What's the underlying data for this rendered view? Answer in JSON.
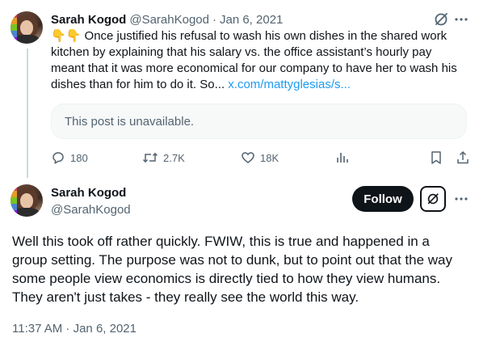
{
  "tweet1": {
    "author_name": "Sarah Kogod",
    "handle": "@SarahKogod",
    "separator": "·",
    "date": "Jan 6, 2021",
    "emoji": "👇👇",
    "text": " Once justified his refusal to wash his own dishes in the shared work kitchen by explaining that his salary vs. the office assistant’s hourly pay meant that it was more economical for our company to have her to wash his dishes than for him to do it. So... ",
    "link_text": "x.com/mattyglesias/s...",
    "quote_unavailable": "This post is unavailable.",
    "actions": {
      "replies": "180",
      "reposts": "2.7K",
      "likes": "18K"
    },
    "icons": {
      "grok": "grok-slash-icon",
      "more": "more-dots-icon",
      "reply": "reply-icon",
      "repost": "repost-icon",
      "like": "heart-icon",
      "views": "views-chart-icon",
      "bookmark": "bookmark-icon",
      "share": "share-icon"
    }
  },
  "tweet2": {
    "author_name": "Sarah Kogod",
    "handle": "@SarahKogod",
    "follow_label": "Follow",
    "text": "Well this took off rather quickly. FWIW, this is true and happened in a group setting. The purpose was not to dunk, but to point out that the way some people view economics is directly tied to how they view humans. They aren't just takes - they really see the world this way.",
    "timestamp": "11:37 AM · Jan 6, 2021"
  },
  "colors": {
    "text": "#0f1419",
    "muted": "#536471",
    "link": "#1d9bf0",
    "border": "#cfd9de",
    "button_bg": "#0f1419"
  }
}
